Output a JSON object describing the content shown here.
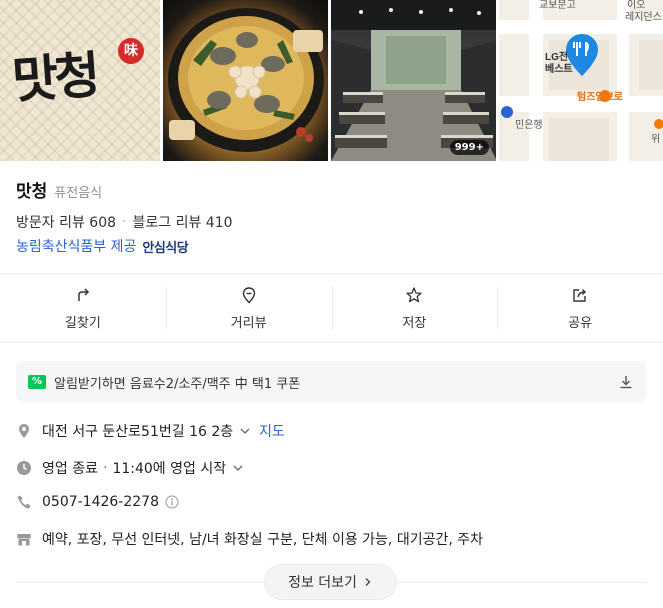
{
  "photos": {
    "logo_text": "맛청",
    "logo_seal": "味",
    "count_badge": "999+",
    "map_labels": [
      "교보문고",
      "이오",
      "레지던스",
      "LG전",
      "베스트",
      "텀즈업브로",
      "민은행",
      "위"
    ]
  },
  "place": {
    "name": "맛청",
    "category": "퓨전음식",
    "visitor_reviews": "방문자 리뷰 608",
    "blog_reviews": "블로그 리뷰 410",
    "separator": "·",
    "cert_text": "농림축산식품부 제공",
    "cert_badge": "안심식당"
  },
  "actions": [
    {
      "label": "길찾기",
      "icon": "directions-icon"
    },
    {
      "label": "거리뷰",
      "icon": "street-view-icon"
    },
    {
      "label": "저장",
      "icon": "star-icon"
    },
    {
      "label": "공유",
      "icon": "share-icon"
    }
  ],
  "coupon": {
    "icon_text": "%",
    "text": "알림받기하면 음료수2/소주/맥주 中 택1 쿠폰"
  },
  "info": {
    "address": "대전 서구 둔산로51번길 16 2층",
    "map_link": "지도",
    "status": "영업 종료",
    "hours": "11:40에 영업 시작",
    "phone": "0507-1426-2278",
    "amenities": "예약, 포장, 무선 인터넷, 남/녀 화장실 구분, 단체 이용 가능, 대기공간, 주차"
  },
  "more_button": "정보 더보기",
  "colors": {
    "link": "#2a63d6",
    "coupon_green": "#03c75a",
    "map_pin": "#1e88e5",
    "map_orange": "#f57c00"
  }
}
